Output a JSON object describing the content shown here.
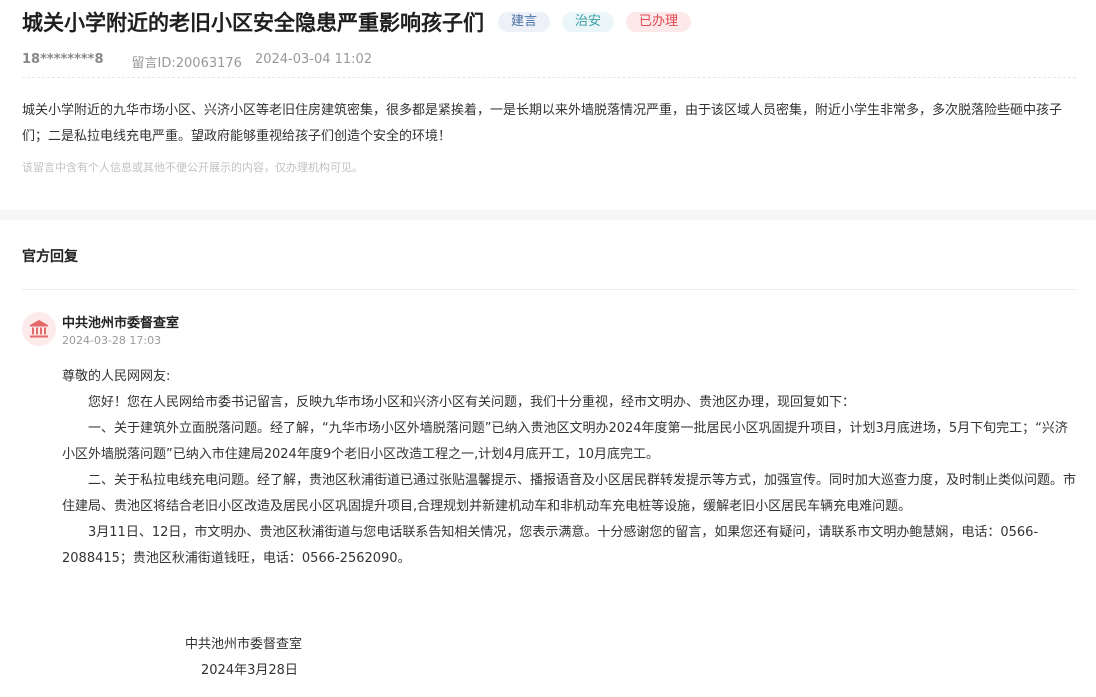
{
  "header": {
    "title": "城关小学附近的老旧小区安全隐患严重影响孩子们",
    "tags": [
      "建言",
      "治安",
      "已办理"
    ],
    "user": "18********8",
    "message_id": "留言ID:20063176",
    "datetime": "2024-03-04 11:02"
  },
  "message": {
    "body": "城关小学附近的九华市场小区、兴济小区等老旧住房建筑密集，很多都是紧挨着，一是长期以来外墙脱落情况严重，由于该区域人员密集，附近小学生非常多，多次脱落险些砸中孩子们；二是私拉电线充电严重。望政府能够重视给孩子们创造个安全的环境！",
    "privacy_notice": "该留言中含有个人信息或其他不便公开展示的内容，仅办理机构可见。"
  },
  "reply_section": {
    "title": "官方回复",
    "org": "中共池州市委督查室",
    "date": "2024-03-28 17:03",
    "greeting": "尊敬的人民网网友:",
    "paragraphs": [
      "您好！您在人民网给市委书记留言，反映九华市场小区和兴济小区有关问题，我们十分重视，经市文明办、贵池区办理，现回复如下：",
      "一、关于建筑外立面脱落问题。经了解，“九华市场小区外墙脱落问题”已纳入贵池区文明办2024年度第一批居民小区巩固提升项目，计划3月底进场，5月下旬完工；“兴济小区外墙脱落问题”已纳入市住建局2024年度9个老旧小区改造工程之一,计划4月底开工，10月底完工。",
      "二、关于私拉电线充电问题。经了解，贵池区秋浦街道已通过张贴温馨提示、播报语音及小区居民群转发提示等方式，加强宣传。同时加大巡查力度，及时制止类似问题。市住建局、贵池区将结合老旧小区改造及居民小区巩固提升项目,合理规划并新建机动车和非机动车充电桩等设施，缓解老旧小区居民车辆充电难问题。",
      "3月11日、12日，市文明办、贵池区秋浦街道与您电话联系告知相关情况，您表示满意。十分感谢您的留言，如果您还有疑问，请联系市文明办鲍慧娴，电话：0566-2088415；贵池区秋浦街道钱旺，电话：0566-2562090。"
    ],
    "signature_org": "中共池州市委督查室",
    "signature_date": "2024年3月28日"
  },
  "colors": {
    "tag_suggest": "#4a6fa5",
    "tag_security": "#3aa2a8",
    "tag_done": "#e0474e",
    "avatar_icon": "#e46a6a"
  },
  "icons": {
    "avatar": "government-building-icon"
  }
}
